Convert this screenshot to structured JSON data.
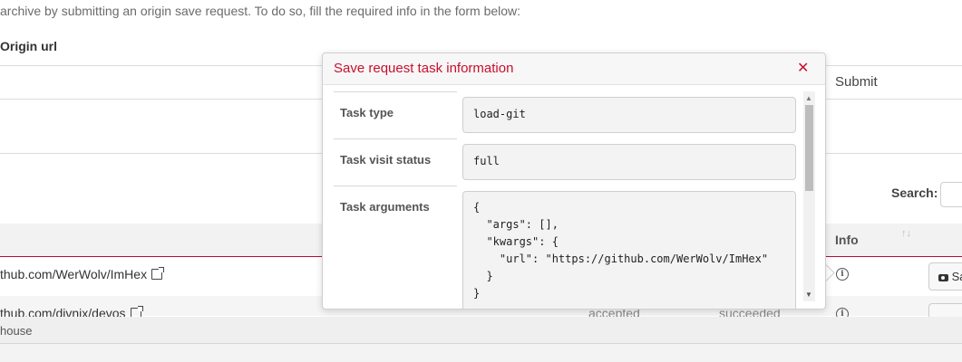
{
  "page": {
    "intro_text": "archive by submitting an origin save request. To do so, fill the required info in the form below:",
    "origin_url_label": "Origin url",
    "submit_label": "Submit",
    "search_label": "Search:",
    "search_value": ""
  },
  "table": {
    "info_header": "Info",
    "sort_icon": "sort-arrows-icon",
    "rows": [
      {
        "origin": "thub.com/WerWolv/ImHex",
        "status": "",
        "task": "",
        "save_label": "Sa"
      },
      {
        "origin": "thub.com/divnix/devos",
        "status": "accepted",
        "task": "succeeded",
        "save_label": ""
      }
    ]
  },
  "footer": {
    "text": "house"
  },
  "popover": {
    "title": "Save request task information",
    "close_icon": "close-icon",
    "fields": [
      {
        "label": "Task type",
        "value": "load-git"
      },
      {
        "label": "Task visit status",
        "value": "full"
      },
      {
        "label": "Task arguments",
        "value": "{\n  \"args\": [],\n  \"kwargs\": {\n    \"url\": \"https://github.com/WerWolv/ImHex\"\n  }\n}"
      }
    ]
  },
  "colors": {
    "accent": "#c8102e",
    "header_underline": "#b30d3a"
  }
}
